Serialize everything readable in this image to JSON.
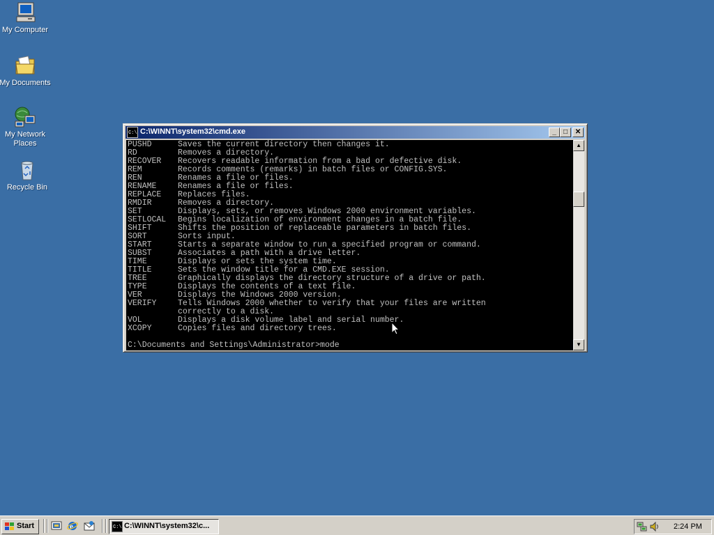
{
  "desktop": {
    "icons": [
      {
        "label": "My Computer"
      },
      {
        "label": "My Documents"
      },
      {
        "label": "My Network Places"
      },
      {
        "label": "Recycle Bin"
      }
    ]
  },
  "window": {
    "title": "C:\\WINNT\\system32\\cmd.exe",
    "controls": {
      "minimize": "_",
      "maximize": "□",
      "close": "✕"
    },
    "console": {
      "lines": [
        {
          "cmd": "PUSHD",
          "desc": "Saves the current directory then changes it."
        },
        {
          "cmd": "RD",
          "desc": "Removes a directory."
        },
        {
          "cmd": "RECOVER",
          "desc": "Recovers readable information from a bad or defective disk."
        },
        {
          "cmd": "REM",
          "desc": "Records comments (remarks) in batch files or CONFIG.SYS."
        },
        {
          "cmd": "REN",
          "desc": "Renames a file or files."
        },
        {
          "cmd": "RENAME",
          "desc": "Renames a file or files."
        },
        {
          "cmd": "REPLACE",
          "desc": "Replaces files."
        },
        {
          "cmd": "RMDIR",
          "desc": "Removes a directory."
        },
        {
          "cmd": "SET",
          "desc": "Displays, sets, or removes Windows 2000 environment variables."
        },
        {
          "cmd": "SETLOCAL",
          "desc": "Begins localization of environment changes in a batch file."
        },
        {
          "cmd": "SHIFT",
          "desc": "Shifts the position of replaceable parameters in batch files."
        },
        {
          "cmd": "SORT",
          "desc": "Sorts input."
        },
        {
          "cmd": "START",
          "desc": "Starts a separate window to run a specified program or command."
        },
        {
          "cmd": "SUBST",
          "desc": "Associates a path with a drive letter."
        },
        {
          "cmd": "TIME",
          "desc": "Displays or sets the system time."
        },
        {
          "cmd": "TITLE",
          "desc": "Sets the window title for a CMD.EXE session."
        },
        {
          "cmd": "TREE",
          "desc": "Graphically displays the directory structure of a drive or path."
        },
        {
          "cmd": "TYPE",
          "desc": "Displays the contents of a text file."
        },
        {
          "cmd": "VER",
          "desc": "Displays the Windows 2000 version."
        },
        {
          "cmd": "VERIFY",
          "desc": "Tells Windows 2000 whether to verify that your files are written"
        },
        {
          "cmd": "",
          "desc": "correctly to a disk."
        },
        {
          "cmd": "VOL",
          "desc": "Displays a disk volume label and serial number."
        },
        {
          "cmd": "XCOPY",
          "desc": "Copies files and directory trees."
        }
      ],
      "prompt": "C:\\Documents and Settings\\Administrator>mode"
    }
  },
  "taskbar": {
    "start_label": "Start",
    "task_label": "C:\\WINNT\\system32\\c...",
    "clock": "2:24 PM"
  }
}
